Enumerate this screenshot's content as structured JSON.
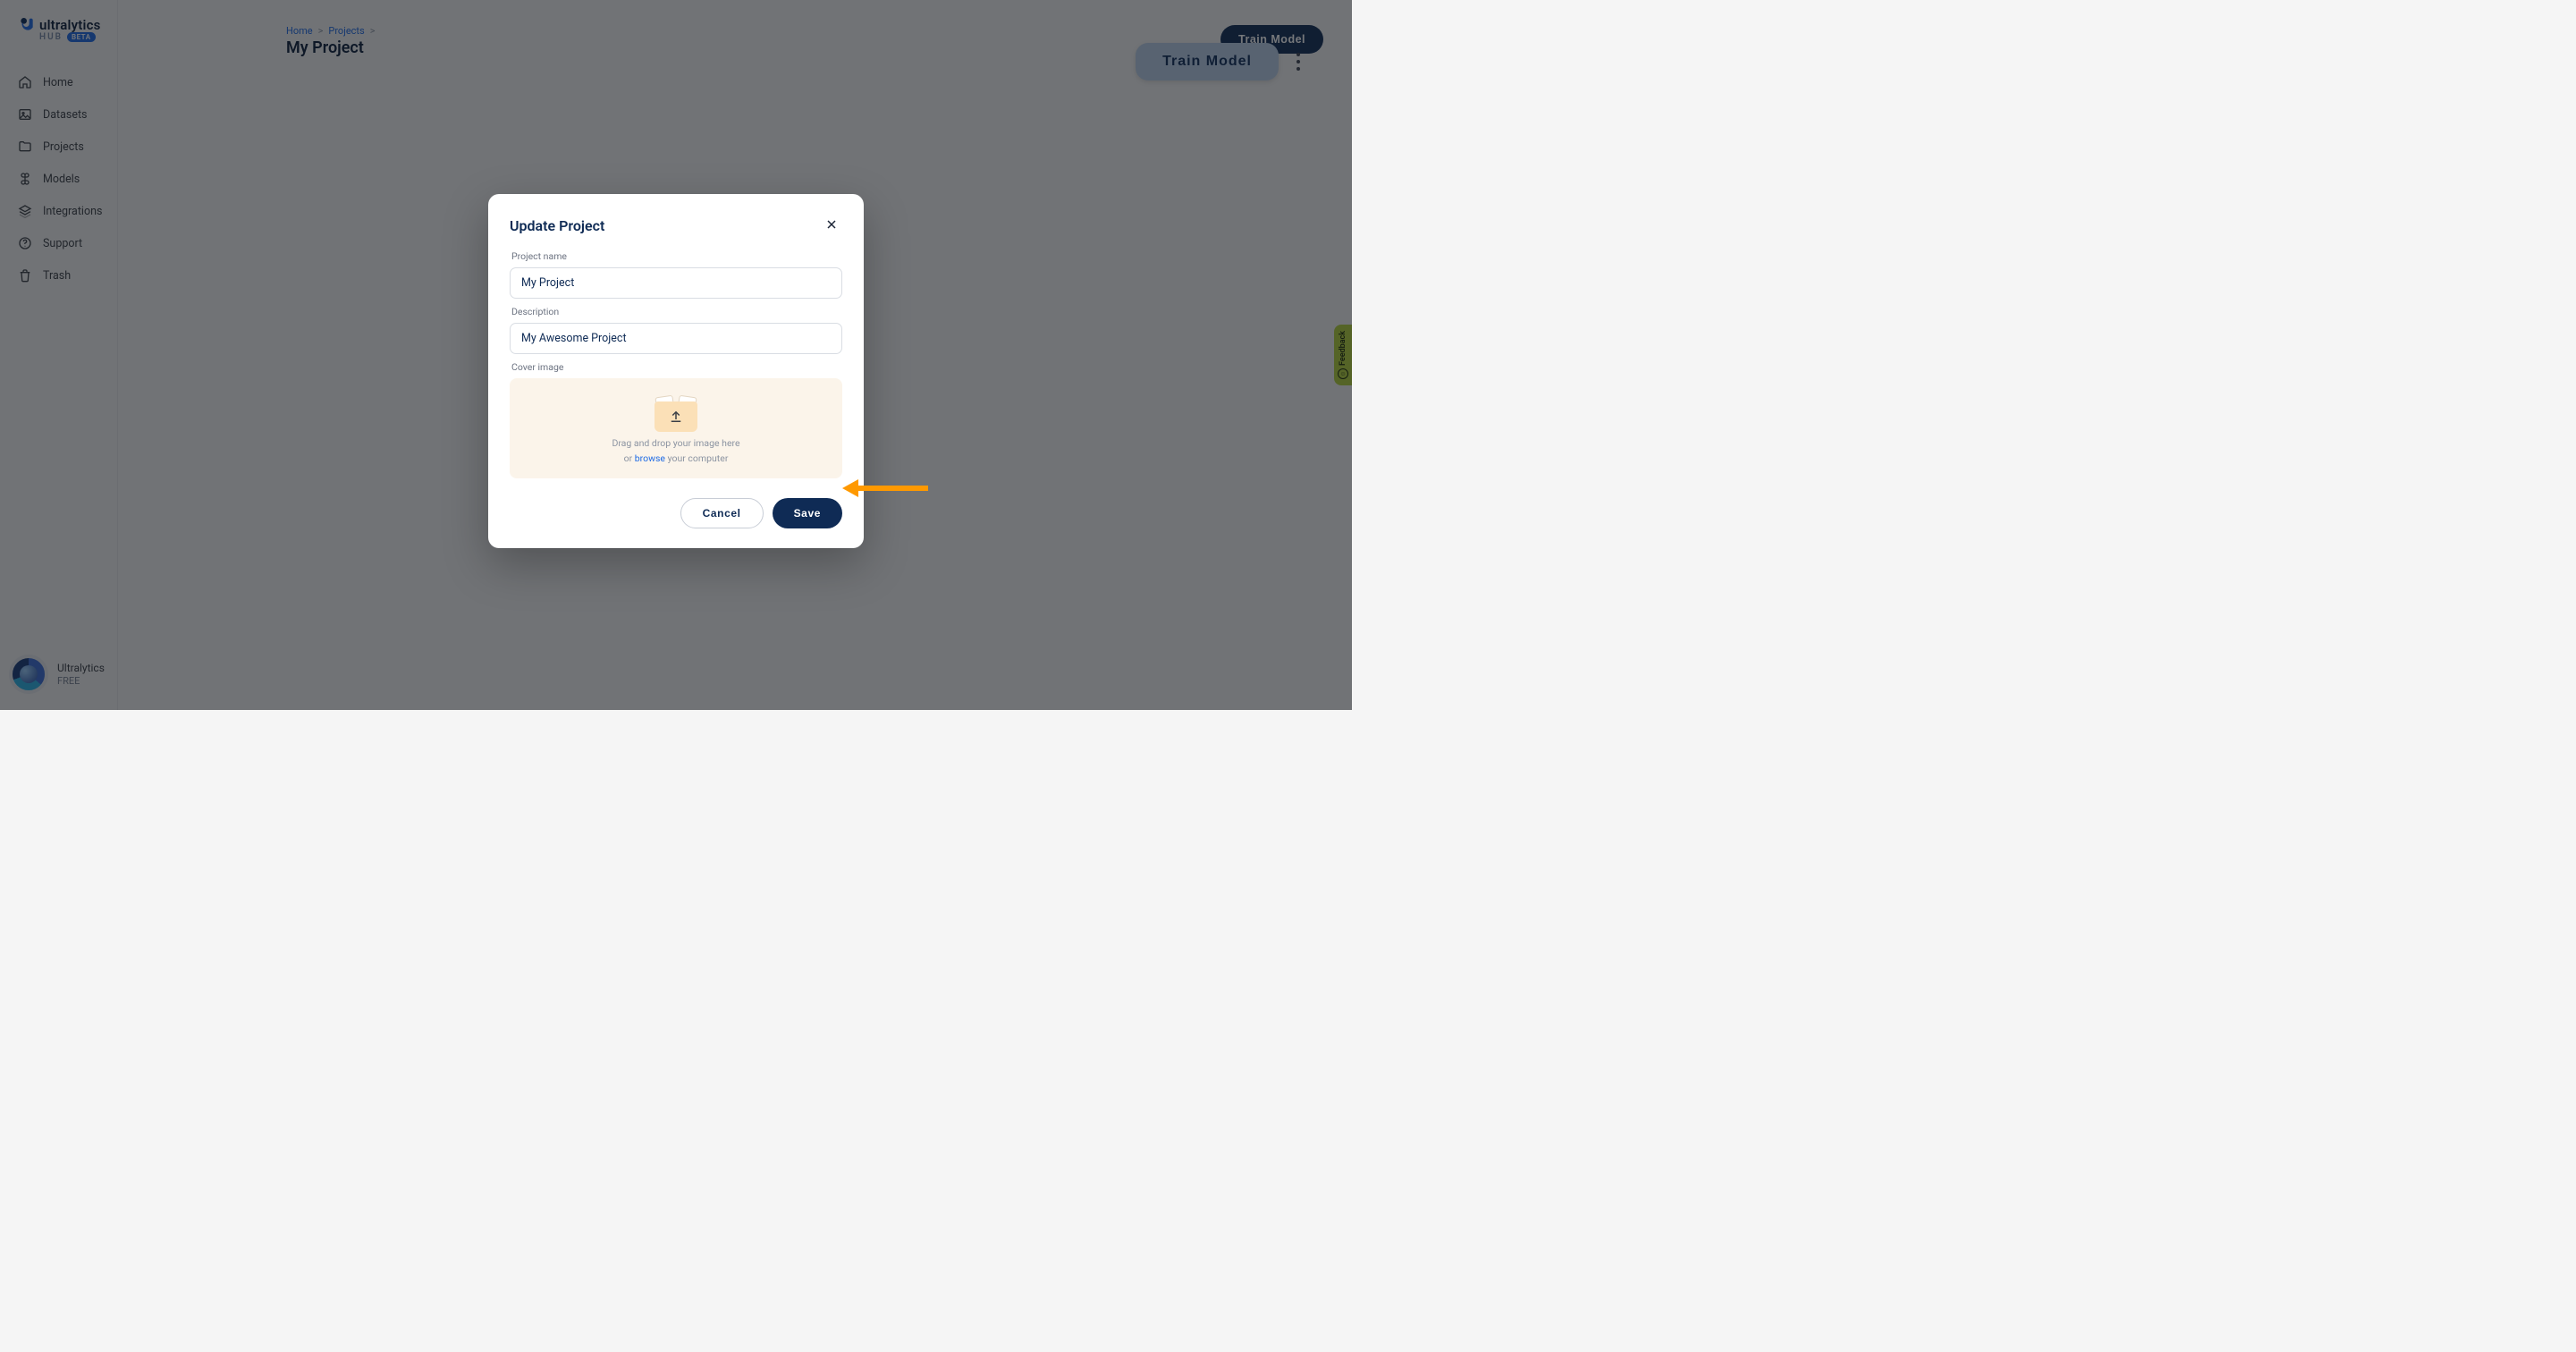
{
  "brand": {
    "name": "ultralytics",
    "sub": "HUB",
    "badge": "BETA"
  },
  "sidebar": {
    "items": [
      {
        "label": "Home"
      },
      {
        "label": "Datasets"
      },
      {
        "label": "Projects"
      },
      {
        "label": "Models"
      },
      {
        "label": "Integrations"
      },
      {
        "label": "Support"
      },
      {
        "label": "Trash"
      }
    ]
  },
  "user": {
    "name": "Ultralytics",
    "plan": "FREE"
  },
  "breadcrumb": {
    "items": [
      "Home",
      "Projects"
    ],
    "sep": ">"
  },
  "page": {
    "title": "My Project"
  },
  "actions": {
    "train_model": "Train Model",
    "train_model_ghost": "Train Model"
  },
  "feedback": {
    "label": "Feedback"
  },
  "modal": {
    "title": "Update Project",
    "fields": {
      "name_label": "Project name",
      "name_value": "My Project",
      "desc_label": "Description",
      "desc_value": "My Awesome Project",
      "cover_label": "Cover image"
    },
    "dropzone": {
      "line1": "Drag and drop your image here",
      "line2_pre": "or ",
      "line2_link": "browse",
      "line2_post": " your computer"
    },
    "buttons": {
      "cancel": "Cancel",
      "save": "Save"
    }
  }
}
